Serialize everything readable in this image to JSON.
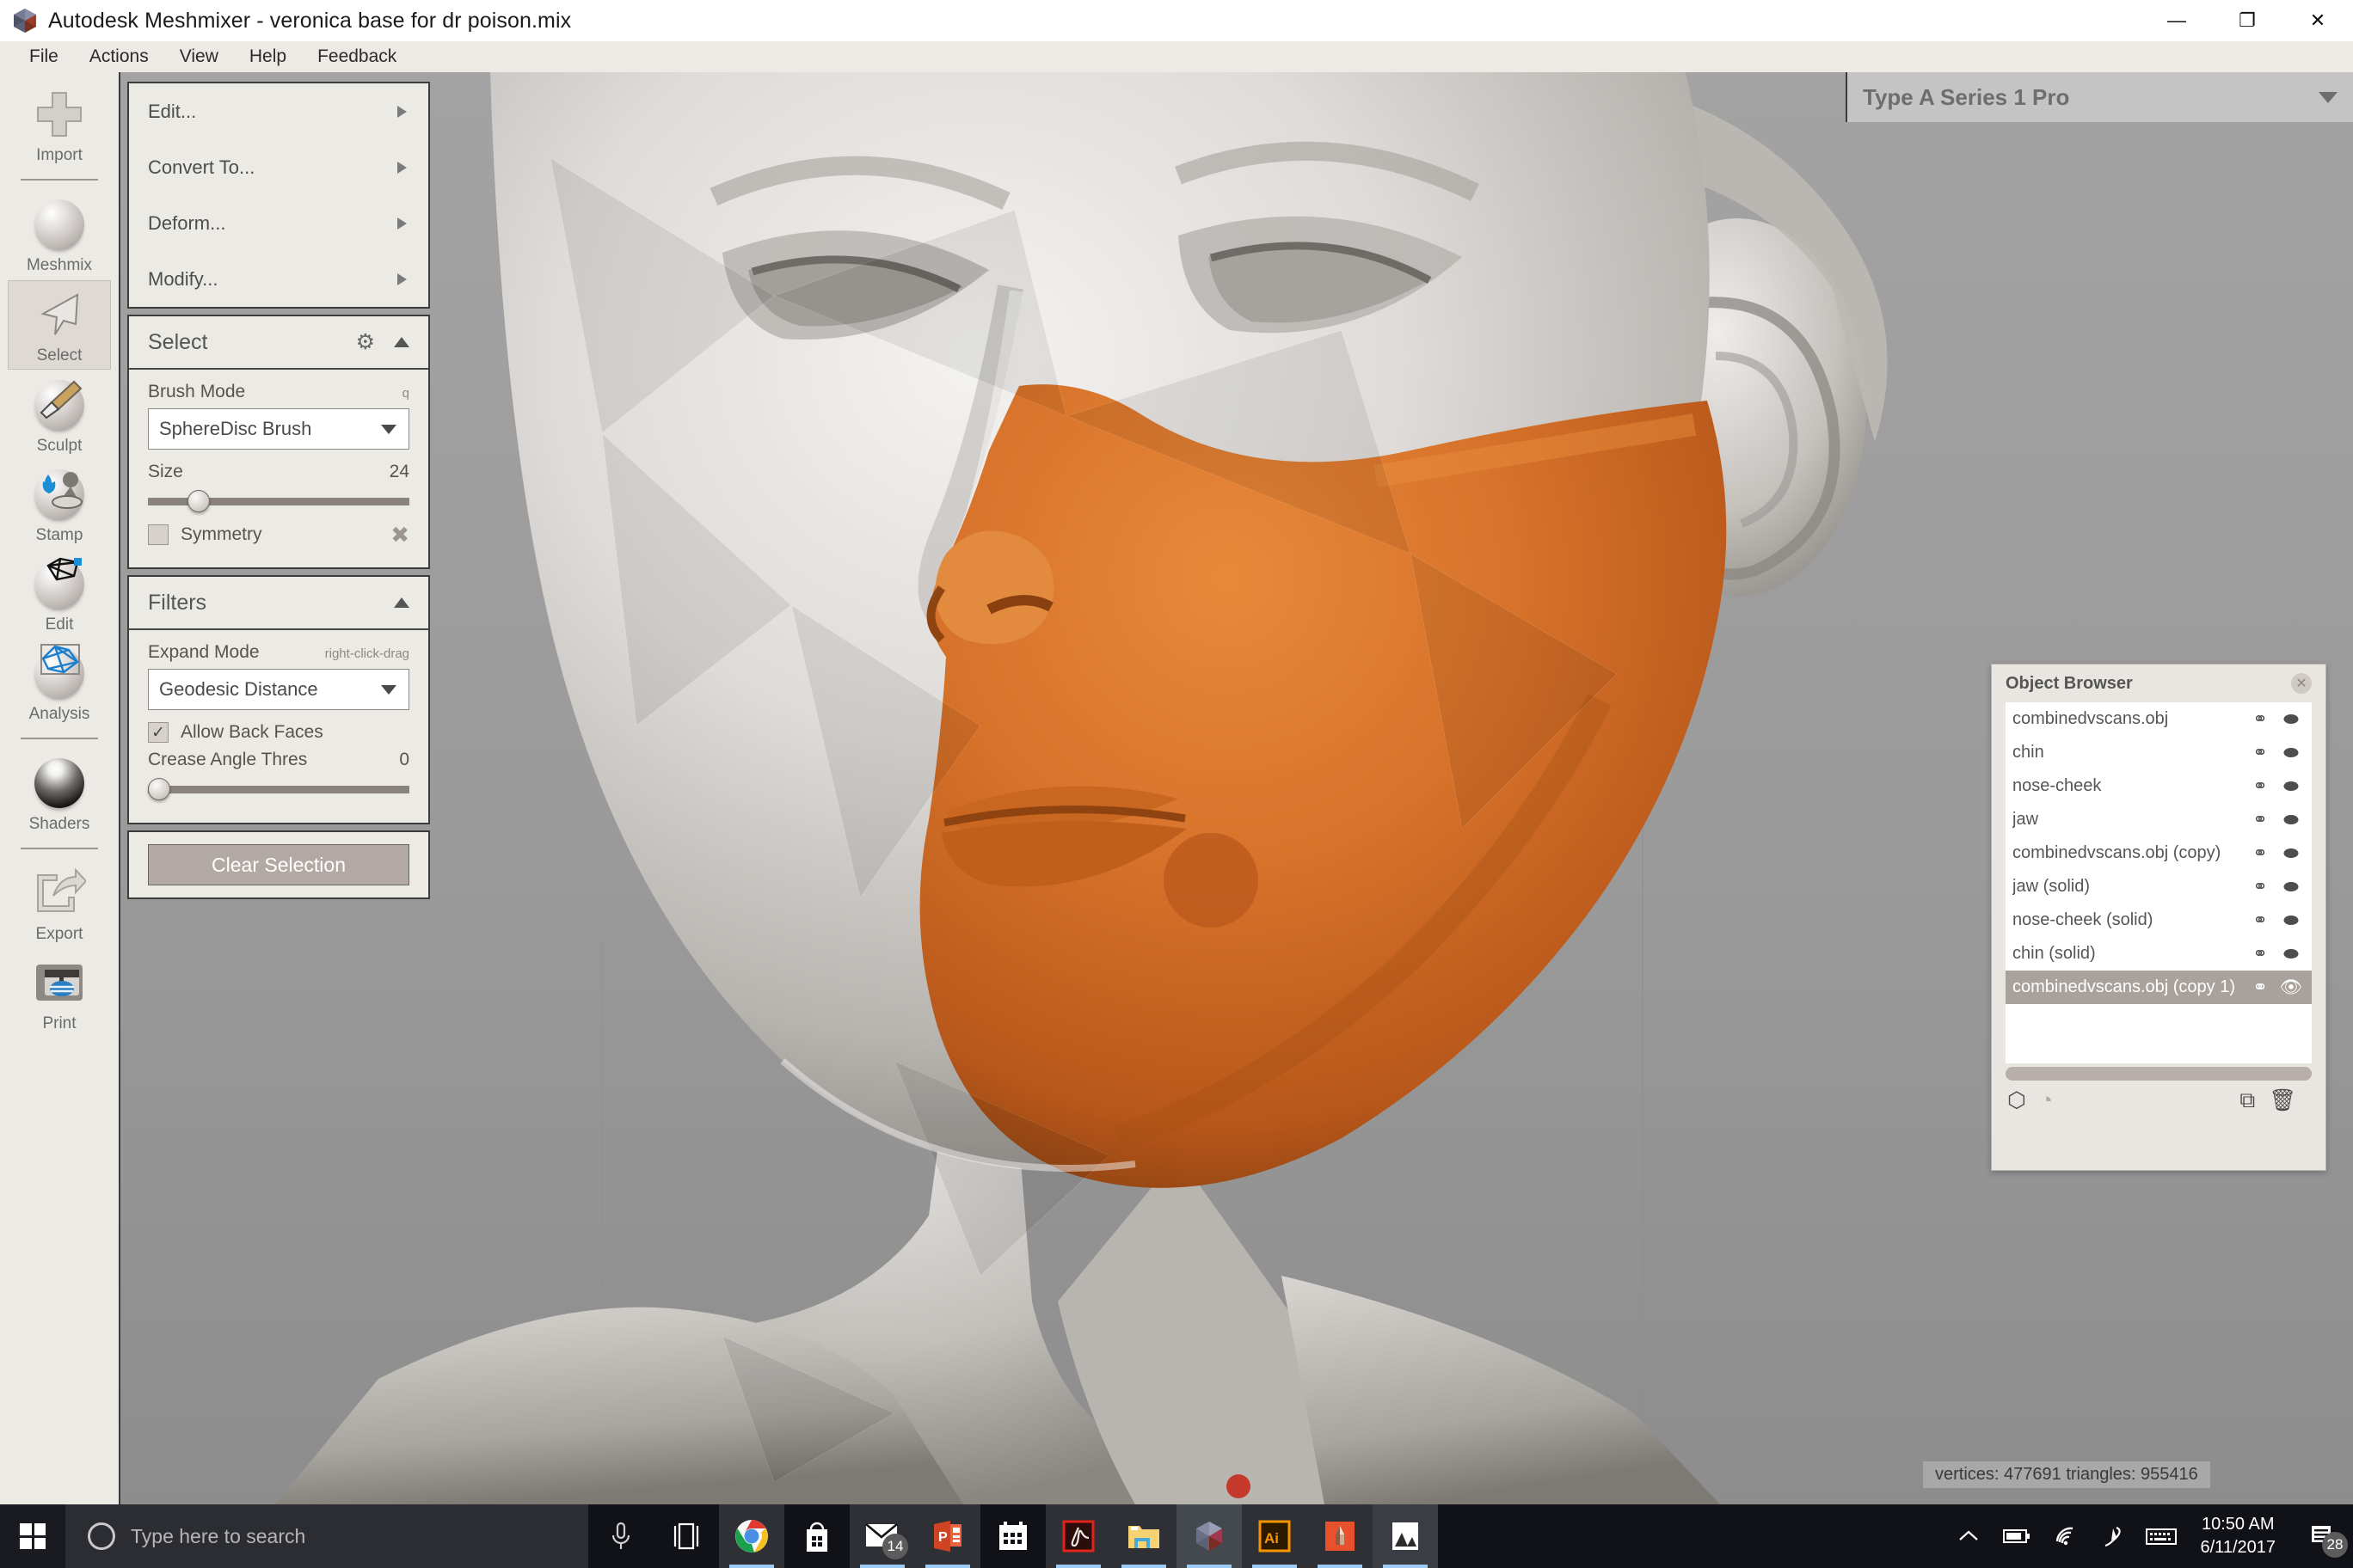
{
  "window": {
    "title": "Autodesk Meshmixer - veronica base for dr poison.mix",
    "app_icon": "meshmixer-logo-icon",
    "controls": [
      {
        "name": "minimize-button",
        "glyph": "—"
      },
      {
        "name": "restore-button",
        "glyph": "❐"
      },
      {
        "name": "close-button",
        "glyph": "✕"
      }
    ]
  },
  "menubar": {
    "items": [
      "File",
      "Actions",
      "View",
      "Help",
      "Feedback"
    ]
  },
  "rail": {
    "items": [
      {
        "label": "Import",
        "icon": "plus-icon",
        "active": false,
        "sep_after": true
      },
      {
        "label": "Meshmix",
        "icon": "face-sphere-icon",
        "active": false,
        "sep_after": false
      },
      {
        "label": "Select",
        "icon": "cursor-arrow-icon",
        "active": true,
        "sep_after": false
      },
      {
        "label": "Sculpt",
        "icon": "brush-sphere-icon",
        "active": false,
        "sep_after": false
      },
      {
        "label": "Stamp",
        "icon": "stamp-sphere-icon",
        "active": false,
        "sep_after": false
      },
      {
        "label": "Edit",
        "icon": "mesh-edit-sphere-icon",
        "active": false,
        "sep_after": false
      },
      {
        "label": "Analysis",
        "icon": "analysis-sphere-icon",
        "active": false,
        "sep_after": true
      },
      {
        "label": "Shaders",
        "icon": "shader-sphere-icon",
        "active": false,
        "sep_after": true
      },
      {
        "label": "Export",
        "icon": "export-arrow-icon",
        "active": false,
        "sep_after": false
      },
      {
        "label": "Print",
        "icon": "printer-icon",
        "active": false,
        "sep_after": false
      }
    ]
  },
  "tool_panel": {
    "actions": [
      {
        "label": "Edit...",
        "icon": "chevron-right-icon"
      },
      {
        "label": "Convert To...",
        "icon": "chevron-right-icon"
      },
      {
        "label": "Deform...",
        "icon": "chevron-right-icon"
      },
      {
        "label": "Modify...",
        "icon": "chevron-right-icon"
      }
    ],
    "select_section": {
      "title": "Select",
      "gear_icon": "gear-icon",
      "collapse_icon": "chevron-up-icon",
      "brush_mode_label": "Brush Mode",
      "brush_mode_hint": "q",
      "brush_mode_value": "SphereDisc Brush",
      "size_label": "Size",
      "size_value": "24",
      "size_percent": 22,
      "symmetry_label": "Symmetry",
      "symmetry_checked": false,
      "symmetry_tool_icon": "wrench-screwdriver-icon"
    },
    "filters_section": {
      "title": "Filters",
      "collapse_icon": "chevron-up-icon",
      "expand_mode_label": "Expand Mode",
      "expand_mode_hint": "right-click-drag",
      "expand_mode_value": "Geodesic Distance",
      "allow_back_faces_label": "Allow Back Faces",
      "allow_back_faces_checked": true,
      "crease_angle_label": "Crease Angle Thres",
      "crease_angle_value": "0",
      "crease_angle_percent": 0
    },
    "clear_selection_label": "Clear Selection"
  },
  "printer_bar": {
    "name": "Type A Series 1 Pro",
    "caret_icon": "chevron-down-icon"
  },
  "object_browser": {
    "title": "Object Browser",
    "close_icon": "close-circle-icon",
    "rows": [
      {
        "name": "combinedvscans.obj",
        "selected": false,
        "pin_icon": "magnet-icon",
        "vis_icon": "eye-closed-icon"
      },
      {
        "name": "chin",
        "selected": false,
        "pin_icon": "magnet-icon",
        "vis_icon": "eye-closed-icon"
      },
      {
        "name": "nose-cheek",
        "selected": false,
        "pin_icon": "magnet-icon",
        "vis_icon": "eye-closed-icon"
      },
      {
        "name": "jaw",
        "selected": false,
        "pin_icon": "magnet-icon",
        "vis_icon": "eye-closed-icon"
      },
      {
        "name": "combinedvscans.obj (copy)",
        "selected": false,
        "pin_icon": "magnet-icon",
        "vis_icon": "eye-closed-icon"
      },
      {
        "name": "jaw (solid)",
        "selected": false,
        "pin_icon": "magnet-icon",
        "vis_icon": "eye-closed-icon"
      },
      {
        "name": "nose-cheek (solid)",
        "selected": false,
        "pin_icon": "magnet-icon",
        "vis_icon": "eye-closed-icon"
      },
      {
        "name": "chin (solid)",
        "selected": false,
        "pin_icon": "magnet-icon",
        "vis_icon": "eye-closed-icon"
      },
      {
        "name": "combinedvscans.obj (copy 1)",
        "selected": true,
        "pin_icon": "magnet-icon",
        "vis_icon": "eye-open-icon"
      }
    ],
    "footer_icons": [
      {
        "name": "cube-icon",
        "glyph": "⬡",
        "dim": false
      },
      {
        "name": "pie-clock-icon",
        "glyph": "◔",
        "dim": true
      },
      {
        "name": "duplicate-icon",
        "glyph": "⧉",
        "dim": false
      },
      {
        "name": "trash-icon",
        "glyph": "🗑",
        "dim": false
      }
    ]
  },
  "status": {
    "text": "vertices: 477691 triangles: 955416"
  },
  "taskbar": {
    "start_icon": "windows-start-icon",
    "search_placeholder": "Type here to search",
    "cortana_icon": "cortana-circle-icon",
    "buttons": [
      {
        "name": "microphone-icon",
        "running": false,
        "underline": false
      },
      {
        "name": "task-view-icon",
        "running": false,
        "underline": false
      },
      {
        "name": "chrome-icon",
        "running": true,
        "underline": true
      },
      {
        "name": "microsoft-store-icon",
        "running": false,
        "underline": false
      },
      {
        "name": "mail-icon",
        "running": true,
        "underline": true,
        "badge": "14"
      },
      {
        "name": "powerpoint-icon",
        "running": true,
        "underline": true
      },
      {
        "name": "calendar-icon",
        "running": false,
        "underline": false
      },
      {
        "name": "acrobat-reader-icon",
        "running": true,
        "underline": true
      },
      {
        "name": "file-explorer-icon",
        "running": true,
        "underline": true
      },
      {
        "name": "meshmixer-icon",
        "running": true,
        "underline": true
      },
      {
        "name": "illustrator-icon",
        "running": true,
        "underline": true
      },
      {
        "name": "sketchable-icon",
        "running": true,
        "underline": true
      },
      {
        "name": "photos-icon",
        "running": true,
        "underline": true
      }
    ],
    "tray": [
      {
        "name": "show-hidden-icons-chevron",
        "glyph": "ⱏ"
      },
      {
        "name": "battery-icon",
        "glyph": "▭"
      },
      {
        "name": "wifi-icon",
        "glyph": "◠"
      },
      {
        "name": "pen-icon",
        "glyph": "✎"
      },
      {
        "name": "keyboard-icon",
        "glyph": "⌨"
      }
    ],
    "clock_time": "10:50 AM",
    "clock_date": "6/11/2017",
    "action_center_icon": "action-center-icon",
    "action_center_badge": "28"
  },
  "colors": {
    "selection_orange": "#d2691e",
    "panel_bg": "#eceae5",
    "accent_blue": "#9ecbf5"
  }
}
